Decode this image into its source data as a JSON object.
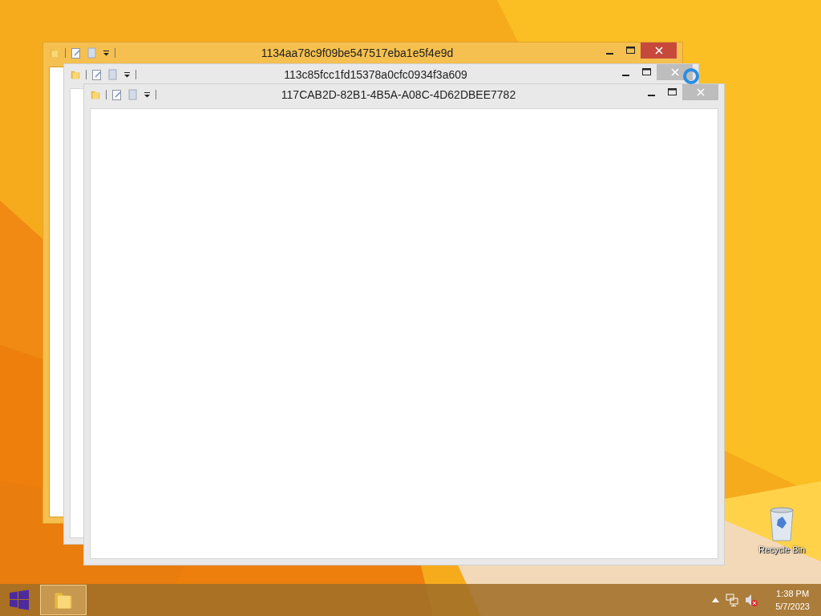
{
  "desktop": {
    "icons": [
      {
        "label": "Recycle Bin"
      }
    ]
  },
  "windows": [
    {
      "title": "1134aa78c9f09be547517eba1e5f4e9d",
      "active": true
    },
    {
      "title": "113c85fcc1fd15378a0cfc0934f3a609",
      "active": false
    },
    {
      "title": "117CAB2D-82B1-4B5A-A08C-4D62DBEE7782",
      "active": false
    }
  ],
  "taskbar": {
    "apps": [
      {
        "kind": "explorer",
        "selected": true
      }
    ],
    "clock": {
      "time": "1:38 PM",
      "date": "5/7/2023"
    }
  }
}
